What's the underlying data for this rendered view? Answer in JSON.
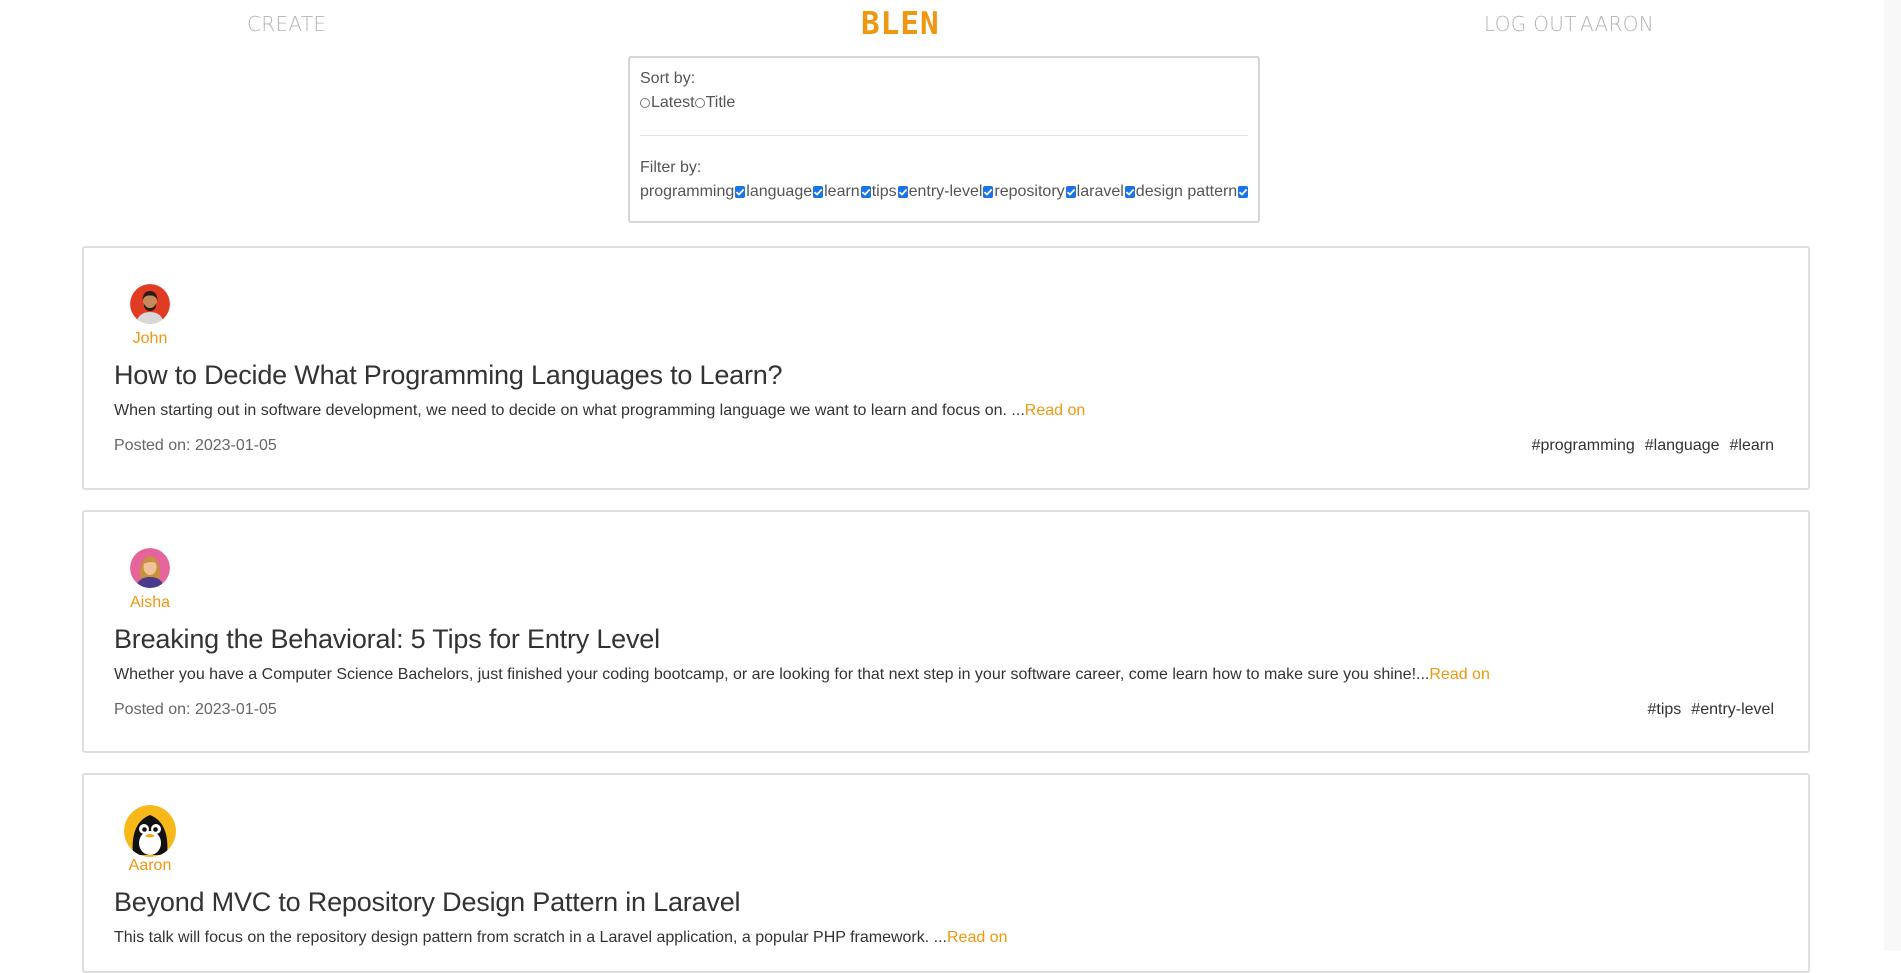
{
  "nav": {
    "create": "CREATE",
    "brand": "BLEN",
    "logout": "LOG OUT",
    "user": "AARON"
  },
  "sort": {
    "label": "Sort by:",
    "options": [
      "Latest",
      "Title"
    ]
  },
  "filter": {
    "label": "Filter by:",
    "options": [
      "programming",
      "language",
      "learn",
      "tips",
      "entry-level",
      "repository",
      "laravel",
      "design pattern"
    ],
    "checked": [
      true,
      true,
      true,
      true,
      true,
      true,
      true,
      true
    ]
  },
  "posts": [
    {
      "author": "John",
      "title": "How to Decide What Programming Languages to Learn?",
      "excerpt": "When starting out in software development, we need to decide on what programming language we want to learn and focus on. ...",
      "read_on": "Read on",
      "posted": "Posted on: 2023-01-05",
      "tags": [
        "#programming",
        "#language",
        "#learn"
      ]
    },
    {
      "author": "Aisha",
      "title": "Breaking the Behavioral: 5 Tips for Entry Level",
      "excerpt": "Whether you have a Computer Science Bachelors, just finished your coding bootcamp, or are looking for that next step in your software career, come learn how to make sure you shine!...",
      "read_on": "Read on",
      "posted": "Posted on: 2023-01-05",
      "tags": [
        "#tips",
        "#entry-level"
      ]
    },
    {
      "author": "Aaron",
      "title": "Beyond MVC to Repository Design Pattern in Laravel",
      "excerpt": "This talk will focus on the repository design pattern from scratch in a Laravel application, a popular PHP framework. ...",
      "read_on": "Read on",
      "posted": "",
      "tags": []
    }
  ],
  "colors": {
    "accent": "#f0960f",
    "checkbox": "#1a73e8"
  }
}
